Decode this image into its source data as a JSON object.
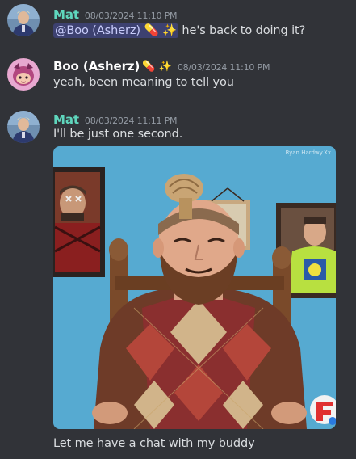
{
  "messages": [
    {
      "author": "Mat",
      "author_color": "#5fd6bd",
      "timestamp": "08/03/2024 11:10 PM",
      "mention": "@Boo (Asherz) 💊 ✨",
      "text": " he's back to doing it?"
    },
    {
      "author": "Boo (Asherz)",
      "author_color": "#ffffff",
      "author_emoji": "💊 ✨",
      "timestamp": "08/03/2024 11:10 PM",
      "text": "yeah, been meaning to tell you"
    },
    {
      "author": "Mat",
      "author_color": "#5fd6bd",
      "timestamp": "08/03/2024 11:11 PM",
      "text": "I'll be just one second.",
      "attachment": {
        "kind": "animated-gif",
        "corner_text": "Ryan.Hardwy.Xx"
      },
      "follow_up_text": "Let me have a chat with my buddy"
    }
  ]
}
